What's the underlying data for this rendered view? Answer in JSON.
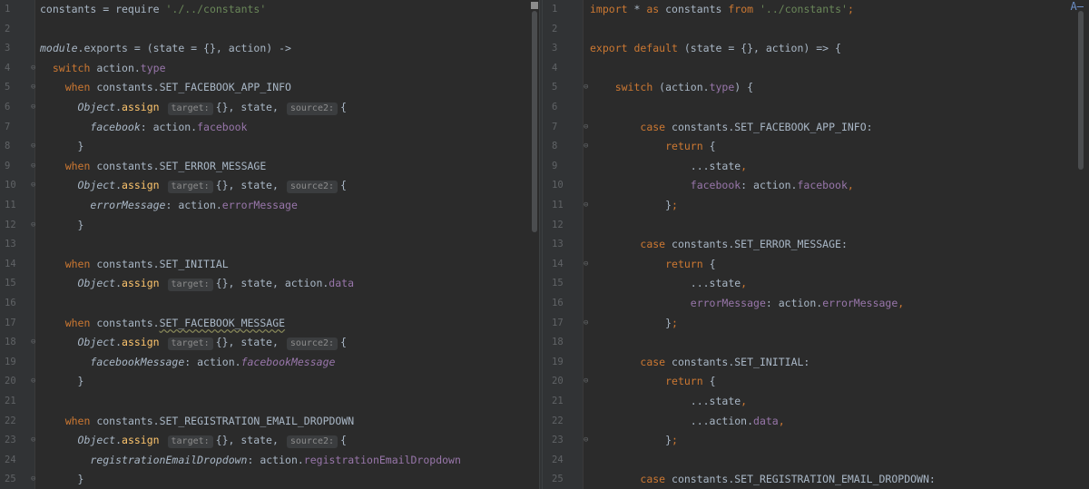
{
  "left": {
    "lines": [
      {
        "n": "1",
        "html": "constants = require <span class=\"str\">'./../constants'</span>"
      },
      {
        "n": "2",
        "html": ""
      },
      {
        "n": "3",
        "html": "<span class=\"glob kw it\">module</span>.exports = (state = {}, action) ->"
      },
      {
        "n": "4",
        "fold": true,
        "html": "  <span class=\"kw\">switch</span> action.<span class=\"prop\">type</span>"
      },
      {
        "n": "5",
        "fold": true,
        "html": "    <span class=\"kw\">when</span> constants.SET_FACEBOOK_APP_INFO"
      },
      {
        "n": "6",
        "fold": true,
        "html": "      <span class=\"it\">Object</span>.<span class=\"fn\">assign</span> <span class=\"hint\">target:</span>{}, state, <span class=\"hint\">source2:</span>{"
      },
      {
        "n": "7",
        "html": "        <span class=\"it\">facebook</span>: action.<span class=\"prop\">facebook</span>"
      },
      {
        "n": "8",
        "fold": true,
        "html": "      }"
      },
      {
        "n": "9",
        "fold": true,
        "html": "    <span class=\"kw\">when</span> constants.SET_ERROR_MESSAGE"
      },
      {
        "n": "10",
        "fold": true,
        "html": "      <span class=\"it\">Object</span>.<span class=\"fn\">assign</span> <span class=\"hint\">target:</span>{}, state, <span class=\"hint\">source2:</span>{"
      },
      {
        "n": "11",
        "html": "        <span class=\"it\">errorMessage</span>: action.<span class=\"prop\">errorMessage</span>"
      },
      {
        "n": "12",
        "fold": true,
        "html": "      }"
      },
      {
        "n": "13",
        "html": ""
      },
      {
        "n": "14",
        "html": "    <span class=\"kw\">when</span> constants.SET_INITIAL"
      },
      {
        "n": "15",
        "html": "      <span class=\"it\">Object</span>.<span class=\"fn\">assign</span> <span class=\"hint\">target:</span>{}, state, action.<span class=\"prop\">data</span>"
      },
      {
        "n": "16",
        "html": ""
      },
      {
        "n": "17",
        "html": "    <span class=\"kw\">when</span> constants.<span class=\"squiggle\">SET_FACEBOOK_MESSAGE</span>"
      },
      {
        "n": "18",
        "fold": true,
        "html": "      <span class=\"it\">Object</span>.<span class=\"fn\">assign</span> <span class=\"hint\">target:</span>{}, state, <span class=\"hint\">source2:</span>{"
      },
      {
        "n": "19",
        "html": "        <span class=\"it\">facebookMessage</span>: action.<span class=\"prop it\">facebookMessage</span>"
      },
      {
        "n": "20",
        "fold": true,
        "html": "      }"
      },
      {
        "n": "21",
        "html": ""
      },
      {
        "n": "22",
        "html": "    <span class=\"kw\">when</span> constants.SET_REGISTRATION_EMAIL_DROPDOWN"
      },
      {
        "n": "23",
        "fold": true,
        "html": "      <span class=\"it\">Object</span>.<span class=\"fn\">assign</span> <span class=\"hint\">target:</span>{}, state, <span class=\"hint\">source2:</span>{"
      },
      {
        "n": "24",
        "html": "        <span class=\"it\">registrationEmailDropdown</span>: action.<span class=\"prop\">registrationEmailDropdown</span>"
      },
      {
        "n": "25",
        "fold": true,
        "html": "      }"
      }
    ]
  },
  "right": {
    "lines": [
      {
        "n": "1",
        "html": "<span class=\"kw\">import</span> * <span class=\"kw\">as</span> constants <span class=\"kw\">from</span> <span class=\"str\">'../constants'</span><span class=\"kw\">;</span>"
      },
      {
        "n": "2",
        "html": ""
      },
      {
        "n": "3",
        "html": "<span class=\"kw\">export default</span> (state = {}, action) => {"
      },
      {
        "n": "4",
        "html": ""
      },
      {
        "n": "5",
        "fold": true,
        "html": "    <span class=\"kw\">switch</span> (action.<span class=\"prop\">type</span>) {"
      },
      {
        "n": "6",
        "html": ""
      },
      {
        "n": "7",
        "fold": true,
        "html": "        <span class=\"kw\">case</span> constants.SET_FACEBOOK_APP_INFO:"
      },
      {
        "n": "8",
        "fold": true,
        "html": "            <span class=\"kw\">return</span> {"
      },
      {
        "n": "9",
        "html": "                ...state<span class=\"kw\">,</span>"
      },
      {
        "n": "10",
        "html": "                <span class=\"prop\">facebook</span>: action.<span class=\"prop\">facebook</span><span class=\"kw\">,</span>"
      },
      {
        "n": "11",
        "fold": true,
        "html": "            }<span class=\"kw\">;</span>"
      },
      {
        "n": "12",
        "html": ""
      },
      {
        "n": "13",
        "html": "        <span class=\"kw\">case</span> constants.SET_ERROR_MESSAGE:"
      },
      {
        "n": "14",
        "fold": true,
        "html": "            <span class=\"kw\">return</span> {"
      },
      {
        "n": "15",
        "html": "                ...state<span class=\"kw\">,</span>"
      },
      {
        "n": "16",
        "html": "                <span class=\"prop\">errorMessage</span>: action.<span class=\"prop\">errorMessage</span><span class=\"kw\">,</span>"
      },
      {
        "n": "17",
        "fold": true,
        "html": "            }<span class=\"kw\">;</span>"
      },
      {
        "n": "18",
        "html": ""
      },
      {
        "n": "19",
        "html": "        <span class=\"kw\">case</span> constants.SET_INITIAL:"
      },
      {
        "n": "20",
        "fold": true,
        "html": "            <span class=\"kw\">return</span> {"
      },
      {
        "n": "21",
        "html": "                ...state<span class=\"kw\">,</span>"
      },
      {
        "n": "22",
        "html": "                ...action.<span class=\"prop\">data</span><span class=\"kw\">,</span>"
      },
      {
        "n": "23",
        "fold": true,
        "html": "            }<span class=\"kw\">;</span>"
      },
      {
        "n": "24",
        "html": ""
      },
      {
        "n": "25",
        "html": "        <span class=\"kw\">case</span> constants.SET_REGISTRATION_EMAIL_DROPDOWN:"
      }
    ]
  },
  "icons": {
    "fold": "fold-marker-icon",
    "inspect": "inspection-icon"
  },
  "colors": {
    "background": "#2b2b2b",
    "keyword": "#cc7832",
    "string": "#6a8759",
    "property": "#9876aa",
    "function": "#ffc66d"
  }
}
